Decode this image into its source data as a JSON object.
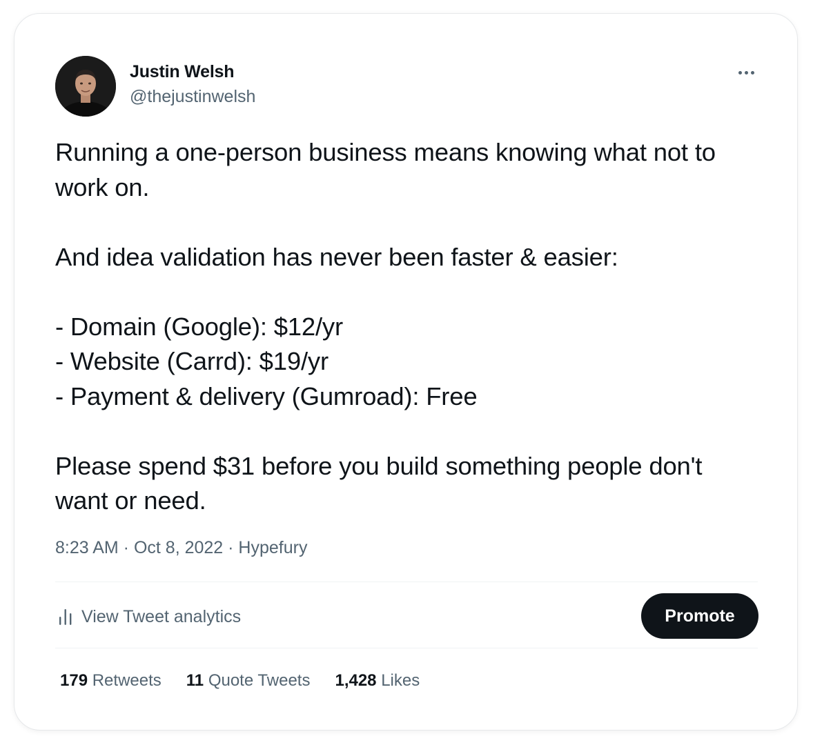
{
  "author": {
    "name": "Justin Welsh",
    "handle": "@thejustinwelsh",
    "avatar_icon": "profile-photo"
  },
  "more_icon": "more-horizontal-icon",
  "tweet": {
    "paragraphs": [
      "Running a one-person business means knowing what not to work on.",
      "And idea validation has never been faster & easier:",
      "- Domain (Google): $12/yr\n- Website (Carrd): $19/yr\n- Payment & delivery (Gumroad): Free",
      "Please spend $31 before you build something people don't want or need."
    ]
  },
  "meta": {
    "time": "8:23 AM",
    "separator": " · ",
    "date": "Oct 8, 2022",
    "source": "Hypefury"
  },
  "actions": {
    "analytics_label": "View Tweet analytics",
    "analytics_icon": "analytics-bars-icon",
    "promote_label": "Promote"
  },
  "stats": {
    "retweets_count": "179",
    "retweets_label": "Retweets",
    "quotes_count": "11",
    "quotes_label": "Quote Tweets",
    "likes_count": "1,428",
    "likes_label": "Likes"
  },
  "colors": {
    "text_primary": "#0f1419",
    "text_secondary": "#536471",
    "button_bg": "#0f1419",
    "divider": "#eff3f4"
  }
}
